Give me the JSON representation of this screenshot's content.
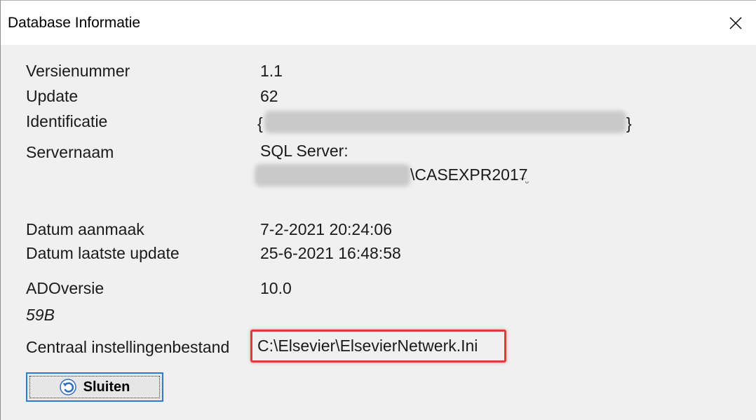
{
  "window": {
    "title": "Database Informatie"
  },
  "labels": {
    "version": "Versienummer",
    "update": "Update",
    "identification": "Identificatie",
    "server": "Servernaam",
    "created": "Datum aanmaak",
    "last_update": "Datum laatste update",
    "ado": "ADOversie",
    "ado_sub": "59B",
    "central_settings": "Centraal instellingenbestand"
  },
  "values": {
    "version": "1.1",
    "update": "62",
    "identification_open": "{",
    "identification_close": "}",
    "server_line1": "SQL Server:",
    "server_line2_suffix": "\\CASEXPR2017",
    "created": "7-2-2021 20:24:06",
    "last_update": "25-6-2021 16:48:58",
    "ado": "10.0",
    "central_settings": "C:\\Elsevier\\ElsevierNetwerk.Ini"
  },
  "buttons": {
    "close_label": "Sluiten"
  },
  "icons": {
    "close": "close-icon",
    "undo": "undo-arrow-icon"
  },
  "colors": {
    "highlight": "#e03a3a",
    "focus": "#2f7bd3"
  }
}
